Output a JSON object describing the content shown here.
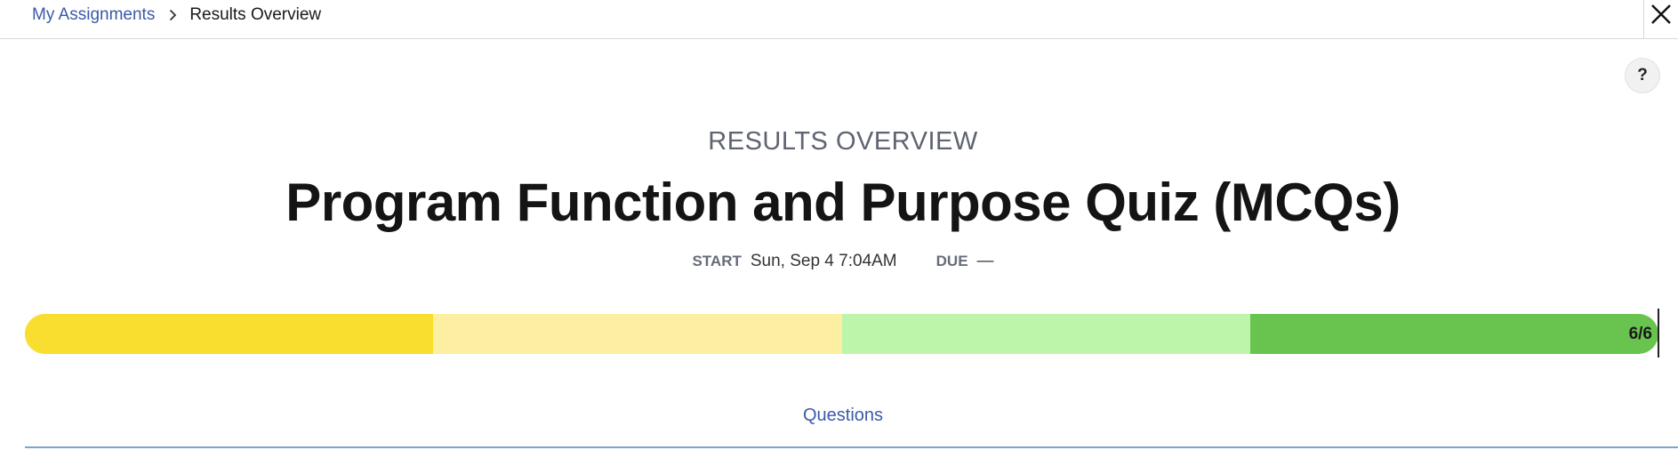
{
  "breadcrumb": {
    "parent": "My Assignments",
    "current": "Results Overview"
  },
  "help": {
    "label": "?"
  },
  "header": {
    "kicker": "RESULTS OVERVIEW",
    "title": "Program Function and Purpose Quiz (MCQs)"
  },
  "meta": {
    "start_label": "START",
    "start_value": "Sun, Sep 4 7:04AM",
    "due_label": "DUE",
    "due_value": "—"
  },
  "progress": {
    "score": "6/6",
    "correct": 6,
    "total": 6,
    "segment_colors": [
      "#f9dd2f",
      "#fcefa2",
      "#bdf5ab",
      "#69c44f"
    ]
  },
  "tabs": {
    "questions": "Questions"
  },
  "colors": {
    "link": "#3b5aa8",
    "tab_underline": "#7ea4c9"
  },
  "icons": {
    "breadcrumb_separator": "chevron-right-icon",
    "close": "close-icon"
  }
}
